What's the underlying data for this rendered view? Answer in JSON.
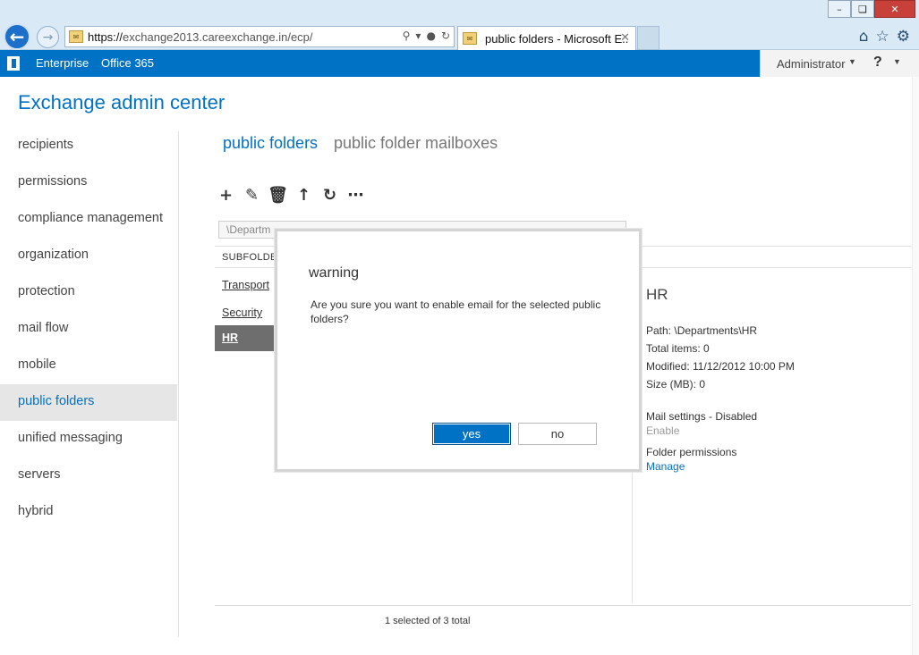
{
  "browser": {
    "url_prefix": "https://",
    "url_host": "exchange2013.careexchange.in",
    "url_path": "/ecp/",
    "tab_title": "public folders - Microsoft E...",
    "window_buttons": [
      "–",
      "❏",
      "✕"
    ]
  },
  "o365_bar": {
    "enterprise": "Enterprise",
    "office365": "Office 365",
    "user": "Administrator",
    "help": "?"
  },
  "page": {
    "title": "Exchange admin center"
  },
  "leftnav": {
    "items": [
      {
        "label": "recipients"
      },
      {
        "label": "permissions"
      },
      {
        "label": "compliance management"
      },
      {
        "label": "organization"
      },
      {
        "label": "protection"
      },
      {
        "label": "mail flow"
      },
      {
        "label": "mobile"
      },
      {
        "label": "public folders"
      },
      {
        "label": "unified messaging"
      },
      {
        "label": "servers"
      },
      {
        "label": "hybrid"
      }
    ],
    "active_index": 7
  },
  "subtabs": {
    "active": "public folders",
    "inactive": "public folder mailboxes"
  },
  "list": {
    "path_value": "\\Departm",
    "column_header": "SUBFOLDER",
    "rows": [
      {
        "label": "Transport"
      },
      {
        "label": "Security"
      },
      {
        "label": "HR"
      }
    ],
    "selected_index": 2,
    "status": "1 selected of 3 total"
  },
  "details": {
    "title": "HR",
    "path": "Path: \\Departments\\HR",
    "total_items": "Total items: 0",
    "modified": "Modified: 11/12/2012 10:00 PM",
    "size": "Size (MB): 0",
    "mail_settings": "Mail settings - Disabled",
    "enable_link": "Enable",
    "folder_permissions": "Folder permissions",
    "manage_link": "Manage"
  },
  "dialog": {
    "title": "warning",
    "message": "Are you sure you want to enable email for the selected public folders?",
    "yes_label": "yes",
    "no_label": "no"
  },
  "colors": {
    "accent": "#0072c6",
    "selected_row": "#6e6e6e"
  }
}
